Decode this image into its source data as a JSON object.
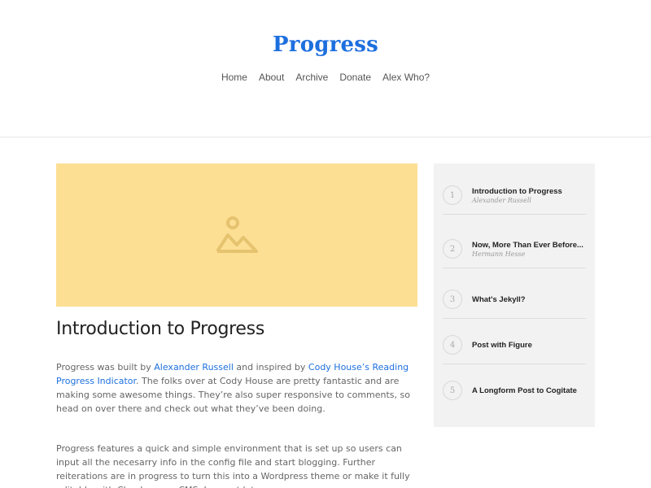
{
  "site": {
    "title": "Progress"
  },
  "nav": {
    "items": [
      {
        "label": "Home"
      },
      {
        "label": "About"
      },
      {
        "label": "Archive"
      },
      {
        "label": "Donate"
      },
      {
        "label": "Alex Who?"
      }
    ]
  },
  "hero": {
    "icon": "image-placeholder-icon",
    "background": "#fddf94",
    "icon_color": "#e5c36f"
  },
  "post": {
    "title": "Introduction to Progress",
    "p1_a": "Progress was built by ",
    "p1_link1": "Alexander Russell",
    "p1_b": " and inspired by ",
    "p1_link2": "Cody House’s Reading Progress Indicator",
    "p1_c": ". The folks over at Cody House are pretty fantastic and are making some awesome things. They’re also super responsive to comments, so head on over there and check out what they’ve been doing.",
    "p2": "Progress features a quick and simple environment that is set up so users can input all the necesarry info in the config file and start blogging. Further reiterations are in progress to turn this into a Wordpress theme or make it fully editable with Cloudcannon CMS. I cannot let you"
  },
  "sidebar": {
    "items": [
      {
        "num": "1",
        "title": "Introduction to Progress",
        "author": "Alexander Russell"
      },
      {
        "num": "2",
        "title": "Now, More Than Ever Before...",
        "author": "Hermann Hesse"
      },
      {
        "num": "3",
        "title": "What's Jekyll?"
      },
      {
        "num": "4",
        "title": "Post with Figure"
      },
      {
        "num": "5",
        "title": "A Longform Post to Cogitate"
      }
    ]
  },
  "colors": {
    "accent": "#1d6fde",
    "sidebar_bg": "#f2f2f2"
  }
}
